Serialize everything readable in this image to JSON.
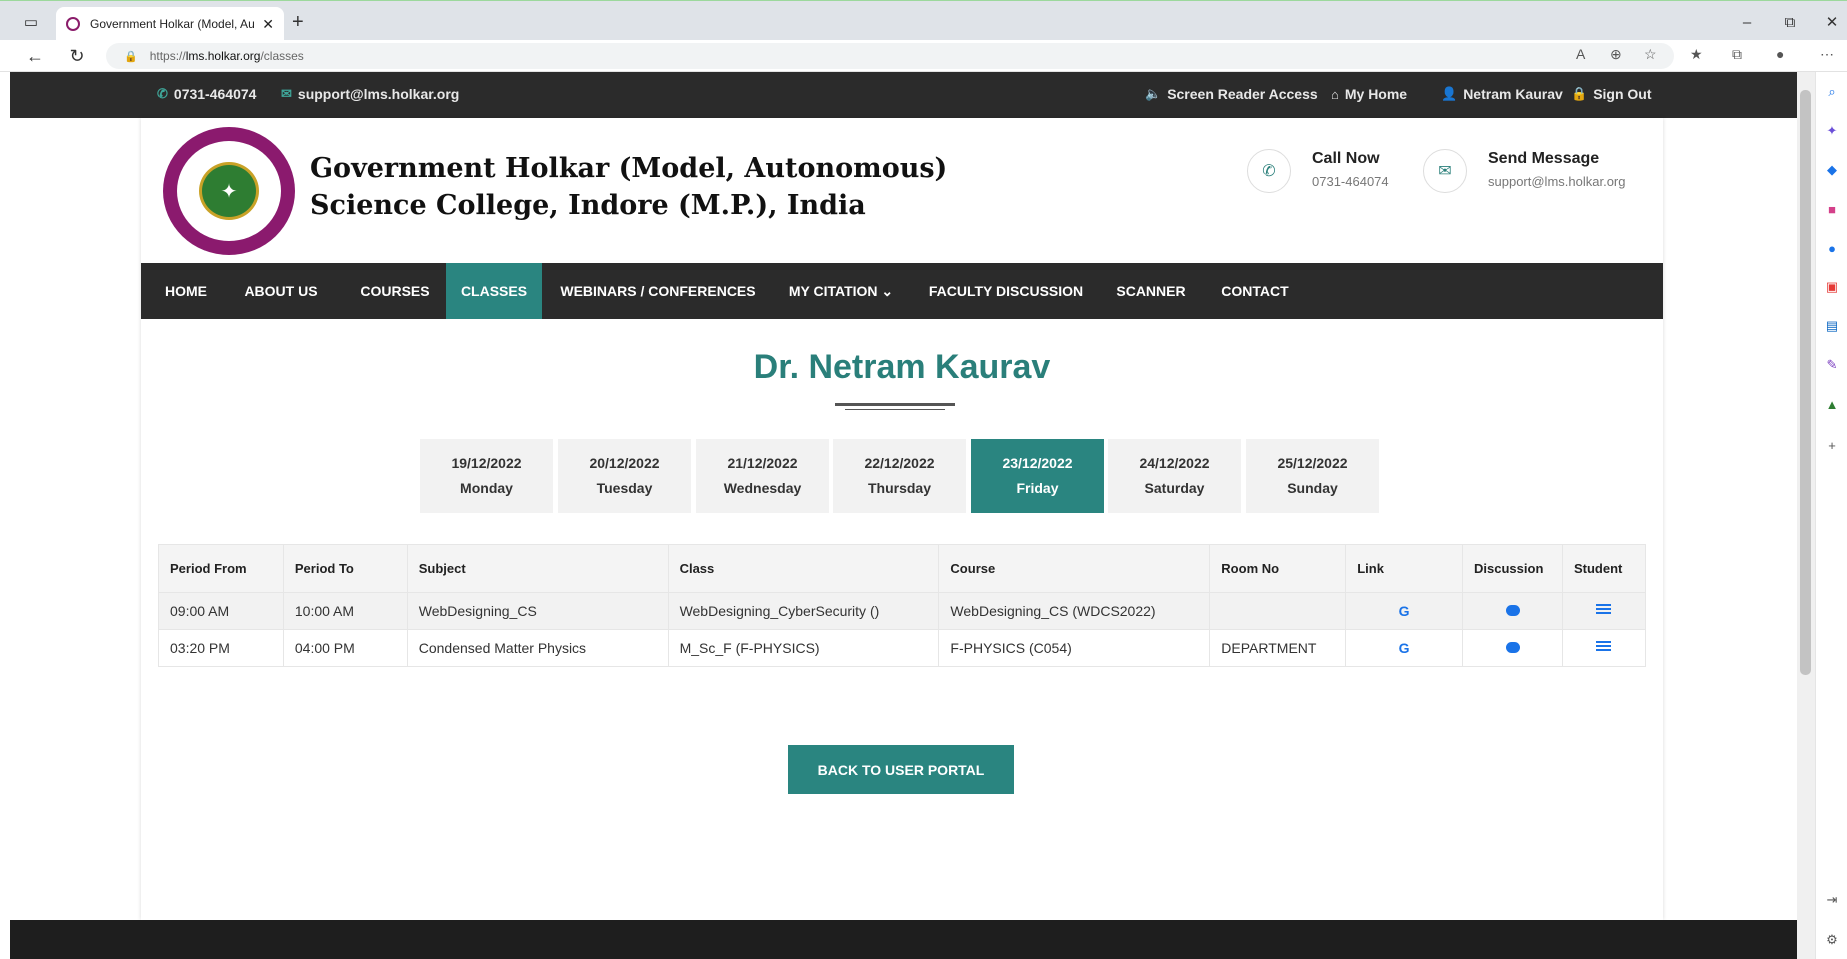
{
  "browser": {
    "tab_title": "Government Holkar (Model, Auto",
    "url_prefix": "https://",
    "url_host": "lms.holkar.org",
    "url_path": "/classes"
  },
  "topbar": {
    "phone": "0731-464074",
    "email": "support@lms.holkar.org",
    "screen_reader": "Screen Reader Access",
    "my_home": "My Home",
    "user": "Netram Kaurav",
    "sign_out": "Sign Out"
  },
  "header": {
    "college_line1": "Government Holkar (Model, Autonomous)",
    "college_line2": "Science College, Indore (M.P.), India",
    "call_title": "Call Now",
    "call_number": "0731-464074",
    "message_title": "Send Message",
    "message_email": "support@lms.holkar.org"
  },
  "nav": [
    {
      "label": "HOME"
    },
    {
      "label": "ABOUT US"
    },
    {
      "label": "COURSES"
    },
    {
      "label": "CLASSES",
      "active": true
    },
    {
      "label": "WEBINARS / CONFERENCES"
    },
    {
      "label": "MY CITATION ⌄"
    },
    {
      "label": "FACULTY DISCUSSION"
    },
    {
      "label": "SCANNER"
    },
    {
      "label": "CONTACT"
    }
  ],
  "page_title": "Dr. Netram Kaurav",
  "days": [
    {
      "date": "19/12/2022",
      "day": "Monday"
    },
    {
      "date": "20/12/2022",
      "day": "Tuesday"
    },
    {
      "date": "21/12/2022",
      "day": "Wednesday"
    },
    {
      "date": "22/12/2022",
      "day": "Thursday"
    },
    {
      "date": "23/12/2022",
      "day": "Friday",
      "active": true
    },
    {
      "date": "24/12/2022",
      "day": "Saturday"
    },
    {
      "date": "25/12/2022",
      "day": "Sunday"
    }
  ],
  "table": {
    "headers": [
      "Period From",
      "Period To",
      "Subject",
      "Class",
      "Course",
      "Room No",
      "Link",
      "Discussion",
      "Student"
    ],
    "rows": [
      {
        "from": "09:00 AM",
        "to": "10:00 AM",
        "subject": "WebDesigning_CS",
        "class": "WebDesigning_CyberSecurity ()",
        "course": "WebDesigning_CS (WDCS2022)",
        "room": ""
      },
      {
        "from": "03:20 PM",
        "to": "04:00 PM",
        "subject": "Condensed Matter Physics",
        "class": "M_Sc_F (F-PHYSICS)",
        "course": "F-PHYSICS (C054)",
        "room": "DEPARTMENT"
      }
    ],
    "link_icon": "G"
  },
  "back_button": "BACK TO USER PORTAL"
}
